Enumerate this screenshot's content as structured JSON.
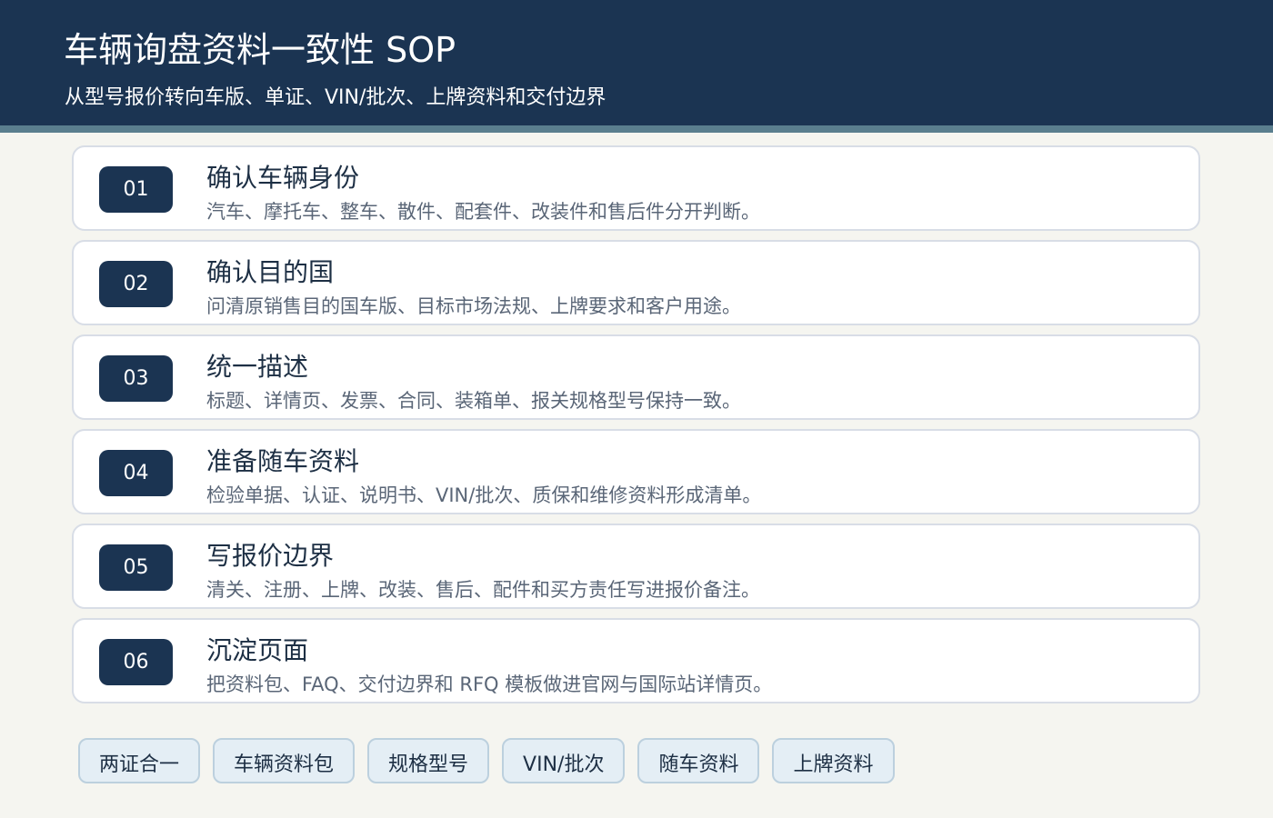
{
  "header": {
    "title": "车辆询盘资料一致性 SOP",
    "subtitle": "从型号报价转向车版、单证、VIN/批次、上牌资料和交付边界"
  },
  "steps": [
    {
      "num": "01",
      "title": "确认车辆身份",
      "desc": "汽车、摩托车、整车、散件、配套件、改装件和售后件分开判断。"
    },
    {
      "num": "02",
      "title": "确认目的国",
      "desc": "问清原销售目的国车版、目标市场法规、上牌要求和客户用途。"
    },
    {
      "num": "03",
      "title": "统一描述",
      "desc": "标题、详情页、发票、合同、装箱单、报关规格型号保持一致。"
    },
    {
      "num": "04",
      "title": "准备随车资料",
      "desc": "检验单据、认证、说明书、VIN/批次、质保和维修资料形成清单。"
    },
    {
      "num": "05",
      "title": "写报价边界",
      "desc": "清关、注册、上牌、改装、售后、配件和买方责任写进报价备注。"
    },
    {
      "num": "06",
      "title": "沉淀页面",
      "desc": "把资料包、FAQ、交付边界和 RFQ 模板做进官网与国际站详情页。"
    }
  ],
  "tags": [
    "两证合一",
    "车辆资料包",
    "规格型号",
    "VIN/批次",
    "随车资料",
    "上牌资料"
  ],
  "colors": {
    "header_bg": "#1b3452",
    "header_stripe": "#5a7e8e",
    "page_bg": "#f5f5f0",
    "badge_bg": "#1b3452",
    "tag_bg": "#e4eef5"
  }
}
